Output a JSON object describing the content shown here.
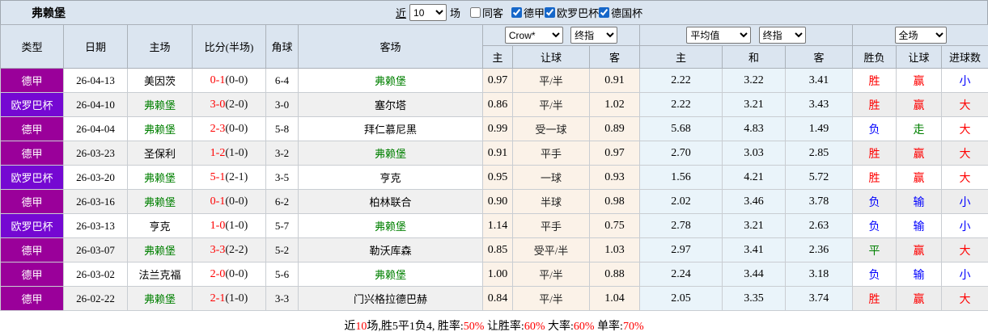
{
  "title": "弗赖堡",
  "toolbar": {
    "recent_label": "近",
    "recent_value": "10",
    "matches_label": "场",
    "same_away_label": "同客",
    "same_away_checked": false,
    "leagues": [
      {
        "label": "德甲",
        "checked": true
      },
      {
        "label": "欧罗巴杯",
        "checked": true
      },
      {
        "label": "德国杯",
        "checked": true
      }
    ]
  },
  "header": {
    "cols": [
      "类型",
      "日期",
      "主场",
      "比分(半场)",
      "角球",
      "客场"
    ],
    "selects": {
      "book": "Crow*",
      "book_final": "终指",
      "avg": "平均值",
      "avg_final": "终指",
      "scope": "全场"
    },
    "sub": [
      "主",
      "让球",
      "客",
      "主",
      "和",
      "客",
      "胜负",
      "让球",
      "进球数"
    ]
  },
  "colors": {
    "league": {
      "bundesliga": "#9A009A",
      "europa": "#7508D2"
    },
    "focus_team": "#008000",
    "red": "#FE0000",
    "blue": "#0000FE",
    "green": "#008000",
    "header_bg": "#DBE5F0",
    "odds_bg": "#FBF2E8",
    "avg_bg": "#EAF4FA"
  },
  "rows": [
    {
      "league": "bundesliga",
      "type": "德甲",
      "date": "26-04-13",
      "home": {
        "name": "美因茨",
        "focus": false
      },
      "score": "0-1",
      "half": "(0-0)",
      "corner": "6-4",
      "away": {
        "name": "弗赖堡",
        "focus": true
      },
      "odds": [
        "0.97",
        "平/半",
        "0.91"
      ],
      "avg": [
        "2.22",
        "3.22",
        "3.41"
      ],
      "results": [
        {
          "t": "胜",
          "c": "red"
        },
        {
          "t": "赢",
          "c": "red"
        },
        {
          "t": "小",
          "c": "blue"
        }
      ]
    },
    {
      "league": "europa",
      "type": "欧罗巴杯",
      "date": "26-04-10",
      "home": {
        "name": "弗赖堡",
        "focus": true
      },
      "score": "3-0",
      "half": "(2-0)",
      "corner": "3-0",
      "away": {
        "name": "塞尔塔",
        "focus": false
      },
      "odds": [
        "0.86",
        "平/半",
        "1.02"
      ],
      "avg": [
        "2.22",
        "3.21",
        "3.43"
      ],
      "results": [
        {
          "t": "胜",
          "c": "red"
        },
        {
          "t": "赢",
          "c": "red"
        },
        {
          "t": "大",
          "c": "red"
        }
      ]
    },
    {
      "league": "bundesliga",
      "type": "德甲",
      "date": "26-04-04",
      "home": {
        "name": "弗赖堡",
        "focus": true
      },
      "score": "2-3",
      "half": "(0-0)",
      "corner": "5-8",
      "away": {
        "name": "拜仁慕尼黑",
        "focus": false
      },
      "odds": [
        "0.99",
        "受一球",
        "0.89"
      ],
      "avg": [
        "5.68",
        "4.83",
        "1.49"
      ],
      "results": [
        {
          "t": "负",
          "c": "blue"
        },
        {
          "t": "走",
          "c": "green"
        },
        {
          "t": "大",
          "c": "red"
        }
      ]
    },
    {
      "league": "bundesliga",
      "type": "德甲",
      "date": "26-03-23",
      "home": {
        "name": "圣保利",
        "focus": false
      },
      "score": "1-2",
      "half": "(1-0)",
      "corner": "3-2",
      "away": {
        "name": "弗赖堡",
        "focus": true
      },
      "odds": [
        "0.91",
        "平手",
        "0.97"
      ],
      "avg": [
        "2.70",
        "3.03",
        "2.85"
      ],
      "results": [
        {
          "t": "胜",
          "c": "red"
        },
        {
          "t": "赢",
          "c": "red"
        },
        {
          "t": "大",
          "c": "red"
        }
      ]
    },
    {
      "league": "europa",
      "type": "欧罗巴杯",
      "date": "26-03-20",
      "home": {
        "name": "弗赖堡",
        "focus": true
      },
      "score": "5-1",
      "half": "(2-1)",
      "corner": "3-5",
      "away": {
        "name": "亨克",
        "focus": false
      },
      "odds": [
        "0.95",
        "一球",
        "0.93"
      ],
      "avg": [
        "1.56",
        "4.21",
        "5.72"
      ],
      "results": [
        {
          "t": "胜",
          "c": "red"
        },
        {
          "t": "赢",
          "c": "red"
        },
        {
          "t": "大",
          "c": "red"
        }
      ]
    },
    {
      "league": "bundesliga",
      "type": "德甲",
      "date": "26-03-16",
      "home": {
        "name": "弗赖堡",
        "focus": true
      },
      "score": "0-1",
      "half": "(0-0)",
      "corner": "6-2",
      "away": {
        "name": "柏林联合",
        "focus": false
      },
      "odds": [
        "0.90",
        "半球",
        "0.98"
      ],
      "avg": [
        "2.02",
        "3.46",
        "3.78"
      ],
      "results": [
        {
          "t": "负",
          "c": "blue"
        },
        {
          "t": "输",
          "c": "blue"
        },
        {
          "t": "小",
          "c": "blue"
        }
      ]
    },
    {
      "league": "europa",
      "type": "欧罗巴杯",
      "date": "26-03-13",
      "home": {
        "name": "亨克",
        "focus": false
      },
      "score": "1-0",
      "half": "(1-0)",
      "corner": "5-7",
      "away": {
        "name": "弗赖堡",
        "focus": true
      },
      "odds": [
        "1.14",
        "平手",
        "0.75"
      ],
      "avg": [
        "2.78",
        "3.21",
        "2.63"
      ],
      "results": [
        {
          "t": "负",
          "c": "blue"
        },
        {
          "t": "输",
          "c": "blue"
        },
        {
          "t": "小",
          "c": "blue"
        }
      ]
    },
    {
      "league": "bundesliga",
      "type": "德甲",
      "date": "26-03-07",
      "home": {
        "name": "弗赖堡",
        "focus": true
      },
      "score": "3-3",
      "half": "(2-2)",
      "corner": "5-2",
      "away": {
        "name": "勒沃库森",
        "focus": false
      },
      "odds": [
        "0.85",
        "受平/半",
        "1.03"
      ],
      "avg": [
        "2.97",
        "3.41",
        "2.36"
      ],
      "results": [
        {
          "t": "平",
          "c": "green"
        },
        {
          "t": "赢",
          "c": "red"
        },
        {
          "t": "大",
          "c": "red"
        }
      ]
    },
    {
      "league": "bundesliga",
      "type": "德甲",
      "date": "26-03-02",
      "home": {
        "name": "法兰克福",
        "focus": false
      },
      "score": "2-0",
      "half": "(0-0)",
      "corner": "5-6",
      "away": {
        "name": "弗赖堡",
        "focus": true
      },
      "odds": [
        "1.00",
        "平/半",
        "0.88"
      ],
      "avg": [
        "2.24",
        "3.44",
        "3.18"
      ],
      "results": [
        {
          "t": "负",
          "c": "blue"
        },
        {
          "t": "输",
          "c": "blue"
        },
        {
          "t": "小",
          "c": "blue"
        }
      ]
    },
    {
      "league": "bundesliga",
      "type": "德甲",
      "date": "26-02-22",
      "home": {
        "name": "弗赖堡",
        "focus": true
      },
      "score": "2-1",
      "half": "(1-0)",
      "corner": "3-3",
      "away": {
        "name": "门兴格拉德巴赫",
        "focus": false
      },
      "odds": [
        "0.84",
        "平/半",
        "1.04"
      ],
      "avg": [
        "2.05",
        "3.35",
        "3.74"
      ],
      "results": [
        {
          "t": "胜",
          "c": "red"
        },
        {
          "t": "赢",
          "c": "red"
        },
        {
          "t": "大",
          "c": "red"
        }
      ]
    }
  ],
  "footer": {
    "segments": [
      {
        "t": "近",
        "c": "black"
      },
      {
        "t": "10",
        "c": "red"
      },
      {
        "t": "场,胜5平1负4, 胜率:",
        "c": "black"
      },
      {
        "t": "50%",
        "c": "red"
      },
      {
        "t": " 让胜率:",
        "c": "black"
      },
      {
        "t": "60%",
        "c": "red"
      },
      {
        "t": " 大率:",
        "c": "black"
      },
      {
        "t": "60%",
        "c": "red"
      },
      {
        "t": " 单率:",
        "c": "black"
      },
      {
        "t": "70%",
        "c": "red"
      }
    ]
  }
}
